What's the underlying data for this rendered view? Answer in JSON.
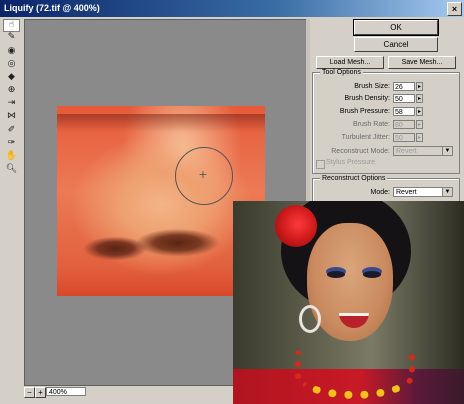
{
  "window": {
    "title": "Liquify (72.tif @ 400%)",
    "close_glyph": "×"
  },
  "tools": [
    {
      "name": "warp-tool-icon",
      "glyph": "☝",
      "active": true
    },
    {
      "name": "reconstruct-tool-icon",
      "glyph": "✎"
    },
    {
      "name": "twirl-clockwise-tool-icon",
      "glyph": "◉"
    },
    {
      "name": "twirl-counterclockwise-tool-icon",
      "glyph": "◎"
    },
    {
      "name": "pucker-tool-icon",
      "glyph": "◆"
    },
    {
      "name": "bloat-tool-icon",
      "glyph": "⊕"
    },
    {
      "name": "shift-pixels-tool-icon",
      "glyph": "⇥"
    },
    {
      "name": "reflection-tool-icon",
      "glyph": "⋈"
    },
    {
      "name": "freeze-tool-icon",
      "glyph": "✐"
    },
    {
      "name": "thaw-tool-icon",
      "glyph": "✑"
    },
    {
      "name": "hand-tool-icon",
      "glyph": "✋"
    },
    {
      "name": "zoom-tool-icon",
      "glyph": "🔍︎"
    }
  ],
  "buttons": {
    "ok": "OK",
    "cancel": "Cancel",
    "load_mesh": "Load Mesh...",
    "save_mesh": "Save Mesh..."
  },
  "tool_options": {
    "legend": "Tool Options",
    "brush_size": {
      "label": "Brush Size:",
      "value": "26"
    },
    "brush_density": {
      "label": "Brush Density:",
      "value": "50"
    },
    "brush_pressure": {
      "label": "Brush Pressure:",
      "value": "58"
    },
    "brush_rate": {
      "label": "Brush Rate:",
      "value": "80"
    },
    "turbulent_jitter": {
      "label": "Turbulent Jitter:",
      "value": "50"
    },
    "reconstruct_mode": {
      "label": "Reconstruct Mode:",
      "value": "Revert"
    },
    "stylus_pressure_label": "Stylus Pressure"
  },
  "reconstruct_options": {
    "legend": "Reconstruct Options",
    "mode": {
      "label": "Mode:",
      "value": "Revert"
    }
  },
  "zoom": {
    "value": "400%",
    "minus_glyph": "−",
    "plus_glyph": "+"
  },
  "colors": {
    "title_start": "#0a246a",
    "title_end": "#a6caf0",
    "skin": "#ec7a55"
  }
}
